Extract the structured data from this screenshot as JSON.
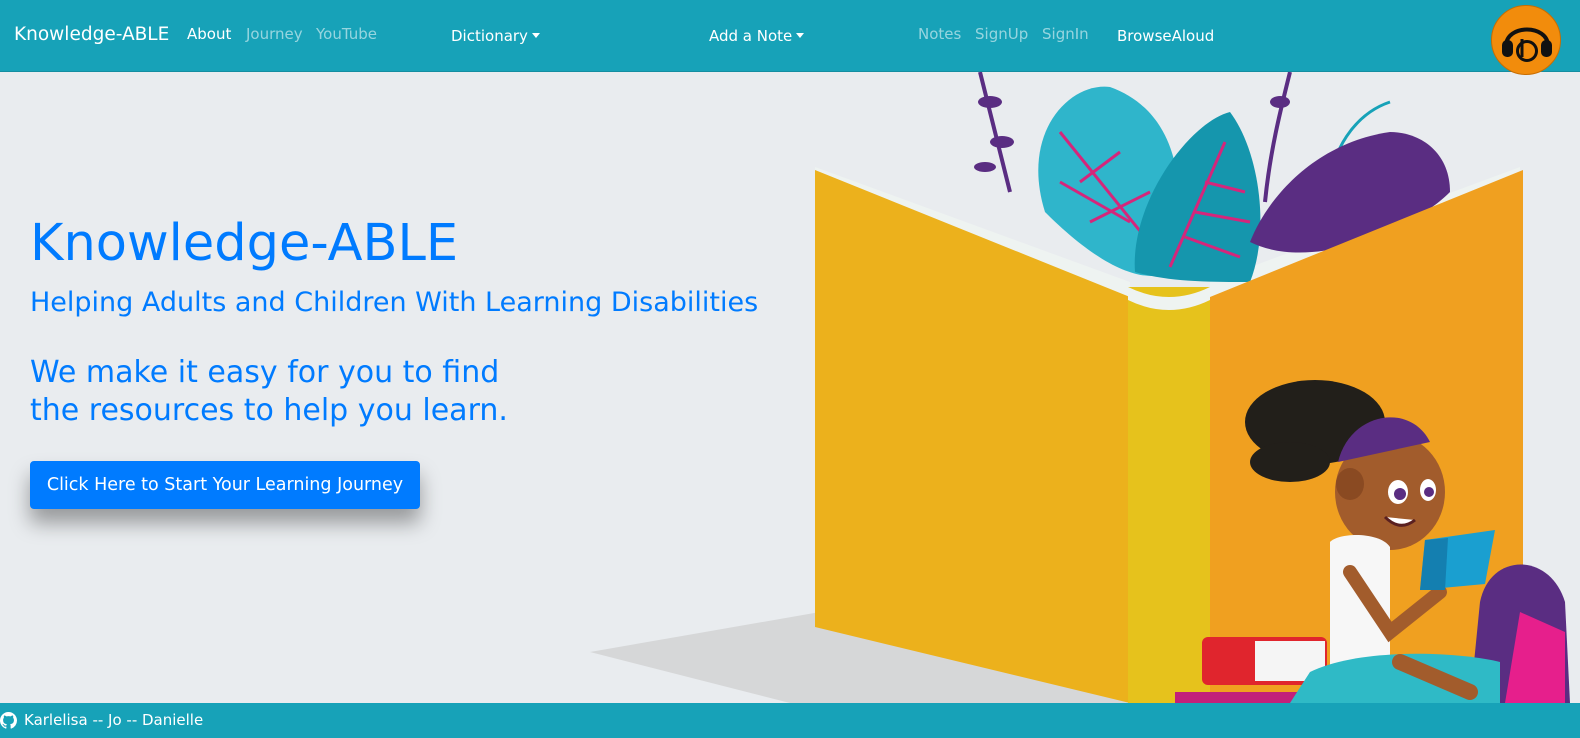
{
  "navbar": {
    "brand": "Knowledge-ABLE",
    "links": {
      "about": "About",
      "journey": "Journey",
      "youtube": "YouTube",
      "dictionary": "Dictionary",
      "add_note": "Add a Note",
      "notes": "Notes",
      "signup": "SignUp",
      "signin": "SignIn",
      "browsealoud": "BrowseAloud"
    },
    "badge_icon": "browsealoud-headphones-icon",
    "colors": {
      "background": "#17a2b8",
      "badge": "#f28c0c"
    }
  },
  "hero": {
    "title": "Knowledge-ABLE",
    "subtitle": "Helping Adults and Children With Learning Disabilities",
    "tagline_line1": "We make it easy for you to find",
    "tagline_line2": "the resources to help you learn.",
    "cta_label": "Click Here to Start Your Learning Journey",
    "colors": {
      "text": "#007bff",
      "button": "#007bff",
      "background": "#e9ecef"
    }
  },
  "footer": {
    "icon": "github-icon",
    "credits": "Karlelisa -- Jo -- Danielle"
  }
}
